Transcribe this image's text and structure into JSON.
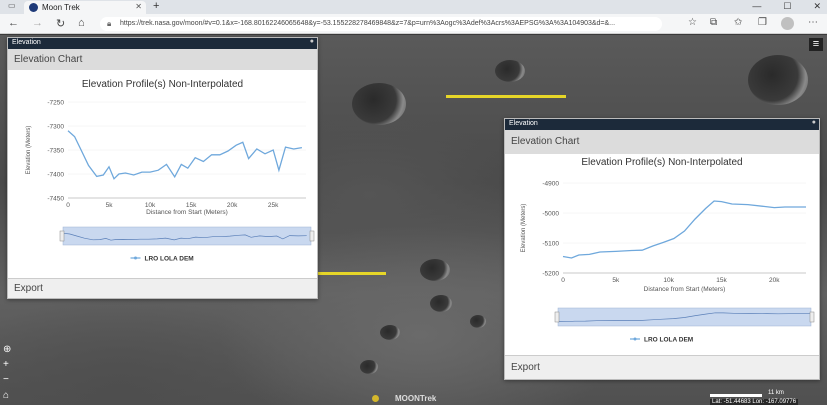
{
  "browser": {
    "tab_title": "Moon Trek",
    "tab_close": "✕",
    "new_tab": "+",
    "url": "https://trek.nasa.gov/moon/#v=0.1&x=-168.80162246065648&y=-53.155228278469848&z=7&p=urn%3Aogc%3Adef%3Acrs%3AEPSG%3A%3A104903&d=&...",
    "window_controls": [
      "—",
      "☐",
      "✕"
    ]
  },
  "map": {
    "logo_text": "MOONTrek",
    "scale_label": "11 km",
    "coords": "Lat: -51.44683 Lon: -167.09776"
  },
  "panel_left": {
    "header": "Elevation",
    "subheader": "Elevation Chart",
    "export": "Export"
  },
  "panel_right": {
    "header": "Elevation",
    "subheader": "Elevation Chart",
    "export": "Export"
  },
  "chart_data": [
    {
      "type": "line",
      "title": "Elevation Profile(s) Non-Interpolated",
      "xlabel": "Distance from Start (Meters)",
      "ylabel": "Elevation (Meters)",
      "xlim": [
        0,
        29000
      ],
      "ylim": [
        -7450,
        -7250
      ],
      "xticks": [
        0,
        5000,
        10000,
        15000,
        20000,
        25000
      ],
      "xtick_labels": [
        "0",
        "5k",
        "10k",
        "15k",
        "20k",
        "25k"
      ],
      "yticks": [
        -7250,
        -7300,
        -7350,
        -7400,
        -7450
      ],
      "ytick_labels": [
        "-7250",
        "-7300",
        "-7350",
        "-7400",
        "-7450"
      ],
      "legend": "LRO LOLA DEM",
      "color": "#6fa8dc",
      "series": [
        {
          "name": "LRO LOLA DEM",
          "x": [
            0,
            800,
            1600,
            2500,
            3500,
            4300,
            5000,
            5600,
            6200,
            7000,
            8000,
            9000,
            10000,
            11000,
            12000,
            13000,
            13800,
            14600,
            15500,
            16500,
            17500,
            18500,
            19500,
            20500,
            21300,
            22000,
            23000,
            24000,
            25000,
            25700,
            26500,
            27500,
            28500
          ],
          "y": [
            -7310,
            -7322,
            -7350,
            -7382,
            -7405,
            -7402,
            -7385,
            -7410,
            -7400,
            -7398,
            -7402,
            -7396,
            -7396,
            -7392,
            -7380,
            -7406,
            -7380,
            -7388,
            -7366,
            -7374,
            -7360,
            -7360,
            -7352,
            -7340,
            -7334,
            -7368,
            -7348,
            -7358,
            -7350,
            -7392,
            -7344,
            -7348,
            -7345
          ]
        }
      ]
    },
    {
      "type": "line",
      "title": "Elevation Profile(s) Non-Interpolated",
      "xlabel": "Distance from Start (Meters)",
      "ylabel": "Elevation (Meters)",
      "xlim": [
        0,
        23000
      ],
      "ylim": [
        -5200,
        -4900
      ],
      "xticks": [
        0,
        5000,
        10000,
        15000,
        20000
      ],
      "xtick_labels": [
        "0",
        "5k",
        "10k",
        "15k",
        "20k"
      ],
      "yticks": [
        -4900,
        -5000,
        -5100,
        -5200
      ],
      "ytick_labels": [
        "-4900",
        "-5000",
        "-5100",
        "-5200"
      ],
      "legend": "LRO LOLA DEM",
      "color": "#6fa8dc",
      "series": [
        {
          "name": "LRO LOLA DEM",
          "x": [
            0,
            800,
            1500,
            2500,
            3500,
            5000,
            6500,
            7500,
            8500,
            9500,
            10500,
            11500,
            12500,
            13500,
            14300,
            15000,
            16000,
            17500,
            19000,
            20000,
            21000,
            22000,
            23000
          ],
          "y": [
            -5145,
            -5150,
            -5140,
            -5138,
            -5130,
            -5128,
            -5125,
            -5124,
            -5110,
            -5098,
            -5085,
            -5060,
            -5020,
            -4985,
            -4960,
            -4962,
            -4970,
            -4972,
            -4978,
            -4982,
            -4980,
            -4980,
            -4980
          ]
        }
      ]
    }
  ]
}
